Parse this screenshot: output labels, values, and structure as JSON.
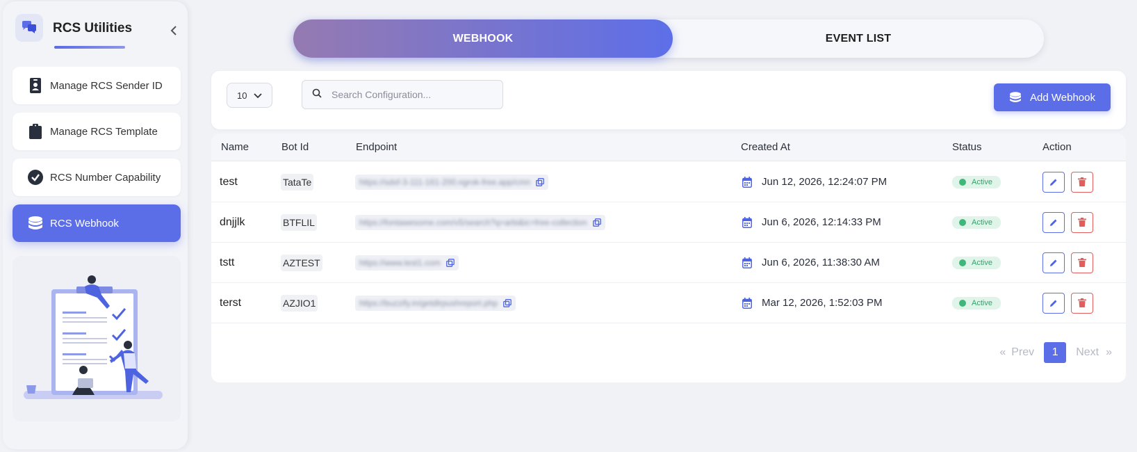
{
  "sidebar": {
    "title": "RCS Utilities",
    "items": [
      {
        "label": "Manage RCS Sender ID",
        "icon": "id-badge-icon"
      },
      {
        "label": "Manage RCS Template",
        "icon": "clipboard-icon"
      },
      {
        "label": "RCS Number Capability",
        "icon": "check-circle-icon"
      },
      {
        "label": "RCS Webhook",
        "icon": "database-icon",
        "active": true
      }
    ]
  },
  "tabs": {
    "webhook": "WEBHOOK",
    "events": "EVENT LIST"
  },
  "toolbar": {
    "page_size": "10",
    "search_placeholder": "Search Configuration...",
    "add_label": "Add Webhook"
  },
  "table": {
    "headers": {
      "name": "Name",
      "bot_id": "Bot Id",
      "endpoint": "Endpoint",
      "created_at": "Created At",
      "status": "Status",
      "action": "Action"
    },
    "rows": [
      {
        "name": "test",
        "bot_id": "TataTe",
        "endpoint": "https://sdsf-3-111-161-200.ngrok-free.app/cmn",
        "created_at": "Jun 12, 2026, 12:24:07 PM",
        "status": "Active"
      },
      {
        "name": "dnjjlk",
        "bot_id": "BTFLIL",
        "endpoint": "https://fontawesome.com/v5/search?q=arbi&ic=free-collection",
        "created_at": "Jun 6, 2026, 12:14:33 PM",
        "status": "Active"
      },
      {
        "name": "tstt",
        "bot_id": "AZTEST",
        "endpoint": "https://www.test1.com",
        "created_at": "Jun 6, 2026, 11:38:30 AM",
        "status": "Active"
      },
      {
        "name": "terst",
        "bot_id": "AZJIO1",
        "endpoint": "https://buzzify.in/getdlrpushreport.php",
        "created_at": "Mar 12, 2026, 1:52:03 PM",
        "status": "Active"
      }
    ]
  },
  "pagination": {
    "first": "«",
    "prev": "Prev",
    "current": "1",
    "next": "Next",
    "last": "»"
  },
  "colors": {
    "accent": "#5b6ee8",
    "active_status": "#3fb77a",
    "delete": "#e35d5d"
  }
}
